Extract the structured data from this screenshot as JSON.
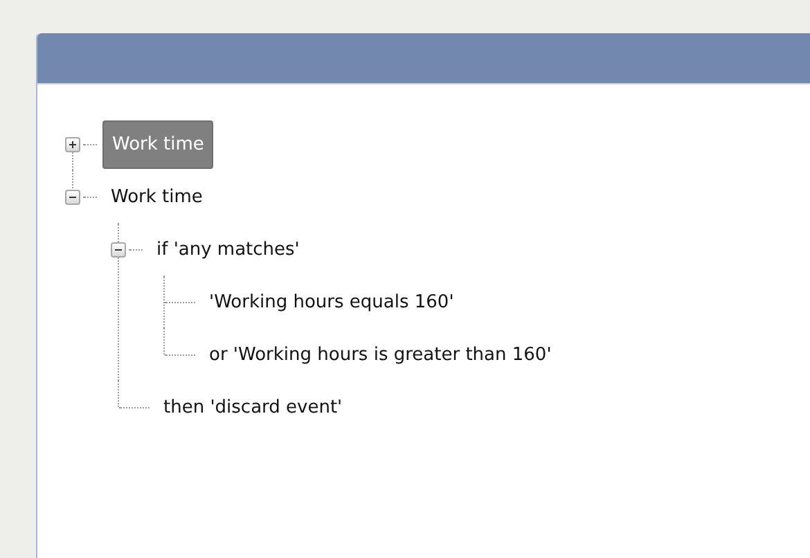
{
  "tree": [
    {
      "label": "Work time",
      "selected": true,
      "expanded": false
    },
    {
      "label": "Work time",
      "selected": false,
      "expanded": true,
      "children": [
        {
          "label": "if 'any matches'",
          "selected": false,
          "expanded": true,
          "children": [
            {
              "label": "'Working hours equals 160'",
              "selected": false
            },
            {
              "label": "or 'Working hours is greater than 160'",
              "selected": false
            }
          ]
        },
        {
          "label": "then 'discard event'",
          "selected": false
        }
      ]
    }
  ]
}
